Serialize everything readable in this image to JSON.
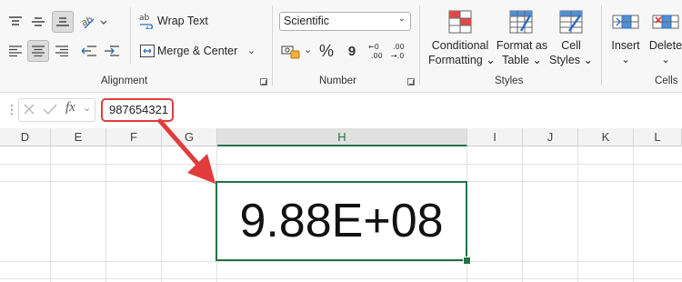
{
  "ribbon": {
    "alignment": {
      "wrap_text": "Wrap Text",
      "merge_center": "Merge & Center",
      "group_label": "Alignment"
    },
    "number": {
      "format_value": "Scientific",
      "group_label": "Number"
    },
    "styles": {
      "conditional": "Conditional\nFormatting",
      "format_table": "Format as\nTable",
      "cell_styles": "Cell\nStyles",
      "group_label": "Styles"
    },
    "cells": {
      "insert": "Insert",
      "delete": "Delete",
      "group_label": "Cells"
    }
  },
  "formula_bar": {
    "fx": "fx",
    "value": "987654321"
  },
  "columns": [
    "D",
    "E",
    "F",
    "G",
    "H",
    "I",
    "J",
    "K",
    "L"
  ],
  "selected_column": "H",
  "selected_cell": {
    "display_value": "9.88E+08"
  },
  "colors": {
    "excel_green": "#217346",
    "annotation_red": "#e03c3c"
  }
}
